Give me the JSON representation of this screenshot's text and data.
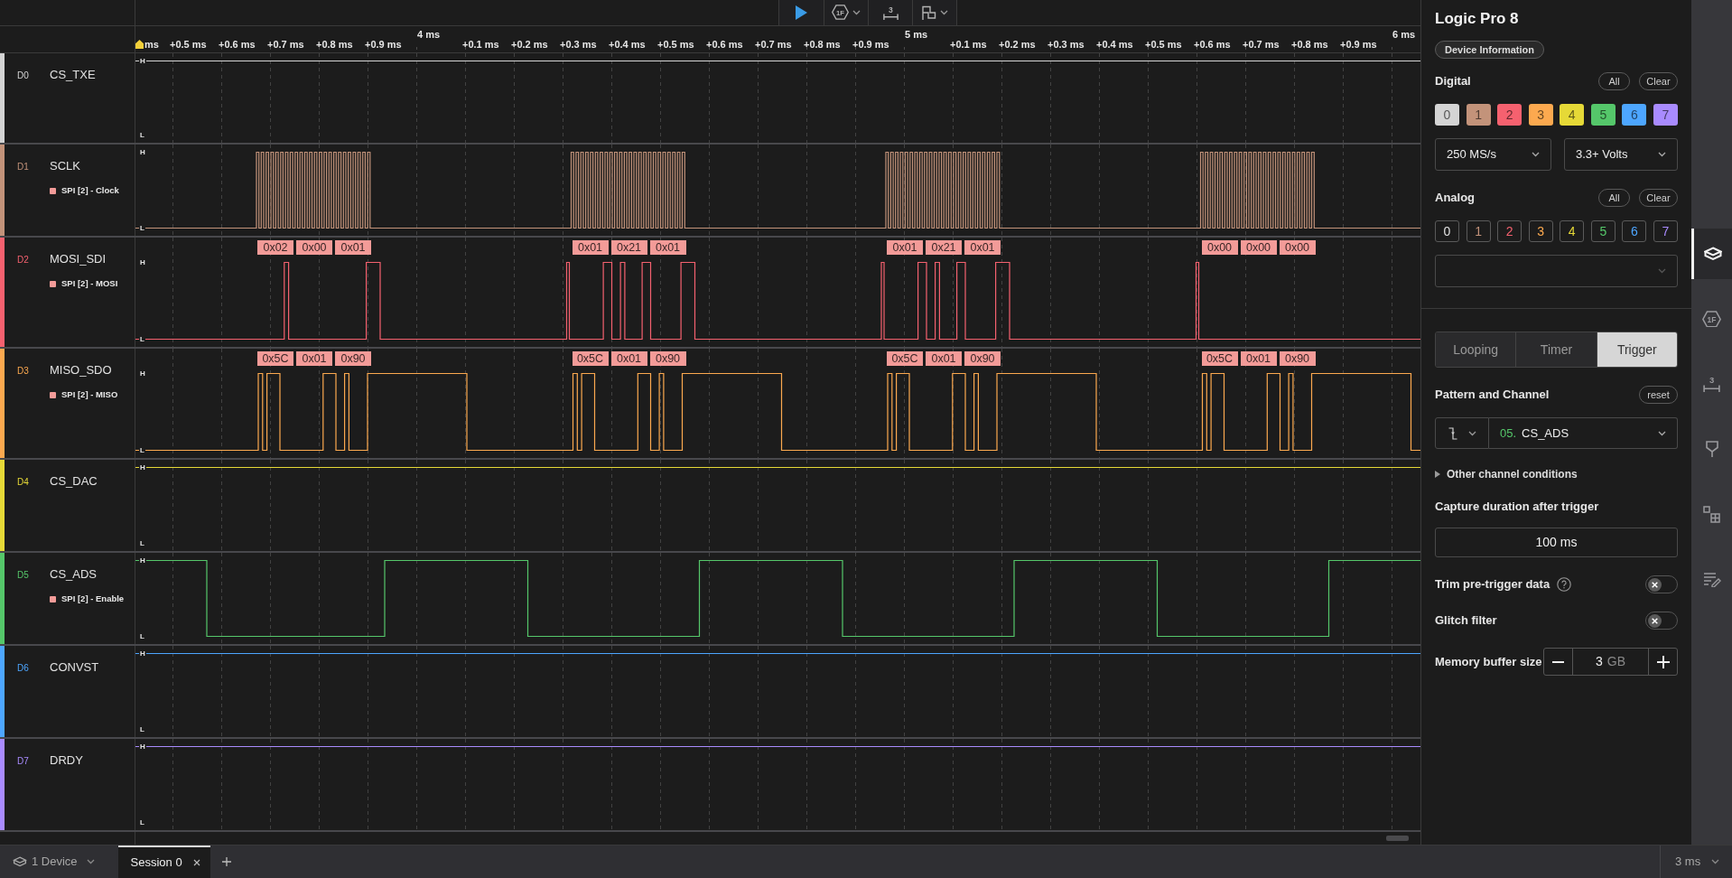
{
  "toolbar": {
    "buttons": [
      {
        "kind": "play",
        "has_menu": false
      },
      {
        "kind": "analyzer",
        "glyph": "1F",
        "has_menu": true
      },
      {
        "kind": "measure",
        "glyph": "3",
        "has_menu": false
      },
      {
        "kind": "note",
        "has_menu": true
      }
    ]
  },
  "ruler": {
    "ticks": [
      {
        "label": "ms",
        "kind": "minor"
      },
      {
        "label": "+0.5 ms",
        "kind": "minor"
      },
      {
        "label": "+0.6 ms",
        "kind": "minor"
      },
      {
        "label": "+0.7 ms",
        "kind": "minor"
      },
      {
        "label": "+0.8 ms",
        "kind": "minor"
      },
      {
        "label": "+0.9 ms",
        "kind": "minor"
      },
      {
        "label": "4 ms",
        "kind": "major"
      },
      {
        "label": "+0.1 ms",
        "kind": "minor"
      },
      {
        "label": "+0.2 ms",
        "kind": "minor"
      },
      {
        "label": "+0.3 ms",
        "kind": "minor"
      },
      {
        "label": "+0.4 ms",
        "kind": "minor"
      },
      {
        "label": "+0.5 ms",
        "kind": "minor"
      },
      {
        "label": "+0.6 ms",
        "kind": "minor"
      },
      {
        "label": "+0.7 ms",
        "kind": "minor"
      },
      {
        "label": "+0.8 ms",
        "kind": "minor"
      },
      {
        "label": "+0.9 ms",
        "kind": "minor"
      },
      {
        "label": "5 ms",
        "kind": "major"
      },
      {
        "label": "+0.1 ms",
        "kind": "minor"
      },
      {
        "label": "+0.2 ms",
        "kind": "minor"
      },
      {
        "label": "+0.3 ms",
        "kind": "minor"
      },
      {
        "label": "+0.4 ms",
        "kind": "minor"
      },
      {
        "label": "+0.5 ms",
        "kind": "minor"
      },
      {
        "label": "+0.6 ms",
        "kind": "minor"
      },
      {
        "label": "+0.7 ms",
        "kind": "minor"
      },
      {
        "label": "+0.8 ms",
        "kind": "minor"
      },
      {
        "label": "+0.9 ms",
        "kind": "minor"
      },
      {
        "label": "6 ms",
        "kind": "major"
      }
    ]
  },
  "channels": [
    {
      "id": "D0",
      "name": "CS_TXE",
      "color": "#d4d4d4",
      "kind": "high",
      "high_mark": "H",
      "low_mark": "L"
    },
    {
      "id": "D1",
      "name": "SCLK",
      "color": "#c3937a",
      "kind": "clock",
      "analyzer": "SPI [2] - Clock",
      "high_mark": "H",
      "low_mark": "L"
    },
    {
      "id": "D2",
      "name": "MOSI_SDI",
      "color": "#f5616f",
      "kind": "mosi",
      "analyzer": "SPI [2] - MOSI",
      "high_mark": "H",
      "low_mark": "L",
      "frames": [
        [
          "0x02",
          "0x00",
          "0x01"
        ],
        [
          "0x01",
          "0x21",
          "0x01"
        ],
        [
          "0x01",
          "0x21",
          "0x01"
        ],
        [
          "0x00",
          "0x00",
          "0x00"
        ]
      ]
    },
    {
      "id": "D3",
      "name": "MISO_SDO",
      "color": "#fca94f",
      "kind": "miso",
      "analyzer": "SPI [2] - MISO",
      "high_mark": "H",
      "low_mark": "L",
      "frames": [
        [
          "0x5C",
          "0x01",
          "0x90"
        ],
        [
          "0x5C",
          "0x01",
          "0x90"
        ],
        [
          "0x5C",
          "0x01",
          "0x90"
        ],
        [
          "0x5C",
          "0x01",
          "0x90"
        ]
      ]
    },
    {
      "id": "D4",
      "name": "CS_DAC",
      "color": "#e6d937",
      "kind": "high",
      "high_mark": "H",
      "low_mark": "L"
    },
    {
      "id": "D5",
      "name": "CS_ADS",
      "color": "#55c76a",
      "kind": "select",
      "analyzer": "SPI [2] - Enable",
      "high_mark": "H",
      "low_mark": "L"
    },
    {
      "id": "D6",
      "name": "CONVST",
      "color": "#4da6ff",
      "kind": "high",
      "high_mark": "H",
      "low_mark": "L"
    },
    {
      "id": "D7",
      "name": "DRDY",
      "color": "#a98bff",
      "kind": "high",
      "high_mark": "H",
      "low_mark": "L"
    }
  ],
  "device_panel": {
    "title": "Logic Pro 8",
    "info_button": "Device Information",
    "digital": {
      "label": "Digital",
      "all_button": "All",
      "clear_button": "Clear",
      "channels": [
        {
          "label": "0",
          "color": "#d4d4d4",
          "enabled": true
        },
        {
          "label": "1",
          "color": "#c3937a",
          "enabled": true
        },
        {
          "label": "2",
          "color": "#f5616f",
          "enabled": true
        },
        {
          "label": "3",
          "color": "#fca94f",
          "enabled": true
        },
        {
          "label": "4",
          "color": "#e6d937",
          "enabled": true
        },
        {
          "label": "5",
          "color": "#55c76a",
          "enabled": true
        },
        {
          "label": "6",
          "color": "#4da6ff",
          "enabled": true
        },
        {
          "label": "7",
          "color": "#a98bff",
          "enabled": true
        }
      ]
    },
    "sample_rate": "250 MS/s",
    "voltage": "3.3+ Volts",
    "analog": {
      "label": "Analog",
      "all_button": "All",
      "clear_button": "Clear",
      "channels": [
        {
          "label": "0",
          "color": "#e0e0e0",
          "enabled": false
        },
        {
          "label": "1",
          "color": "#c3937a",
          "enabled": false
        },
        {
          "label": "2",
          "color": "#f5616f",
          "enabled": false
        },
        {
          "label": "3",
          "color": "#fca94f",
          "enabled": false
        },
        {
          "label": "4",
          "color": "#e6d937",
          "enabled": false
        },
        {
          "label": "5",
          "color": "#55c76a",
          "enabled": false
        },
        {
          "label": "6",
          "color": "#4da6ff",
          "enabled": false
        },
        {
          "label": "7",
          "color": "#a98bff",
          "enabled": false
        }
      ]
    },
    "analog_sample_rate": {
      "disabled": true
    },
    "capture_modes": [
      {
        "label": "Looping",
        "selected": false
      },
      {
        "label": "Timer",
        "selected": false
      },
      {
        "label": "Trigger",
        "selected": true
      }
    ],
    "trigger": {
      "label": "Pattern and Channel",
      "reset_button": "reset",
      "falling_edge": true,
      "channel_number": "05.",
      "channel_name": "CS_ADS"
    },
    "other_conditions": {
      "label": "Other channel conditions",
      "expanded": false
    },
    "capture_duration": {
      "label": "Capture duration after trigger",
      "value": "100 ms"
    },
    "toggles": [
      {
        "label": "Trim pre-trigger data",
        "help": true,
        "on": false
      },
      {
        "label": "Glitch filter",
        "help": false,
        "on": false
      }
    ],
    "memory_buffer": {
      "label": "Memory buffer size",
      "value": "3",
      "unit": "GB"
    }
  },
  "sidebar_tabs": [
    {
      "kind": "device",
      "selected": true
    },
    {
      "kind": "analyzer",
      "glyph": "1F",
      "selected": false
    },
    {
      "kind": "measure",
      "glyph": "3",
      "selected": false
    },
    {
      "kind": "pin",
      "selected": false
    },
    {
      "kind": "extensions",
      "selected": false
    },
    {
      "kind": "notes",
      "selected": false
    }
  ],
  "status_bar": {
    "device_button": "1 Device",
    "sessions": [
      {
        "label": "Session 0",
        "selected": true
      }
    ],
    "zoom_level": "3 ms"
  }
}
